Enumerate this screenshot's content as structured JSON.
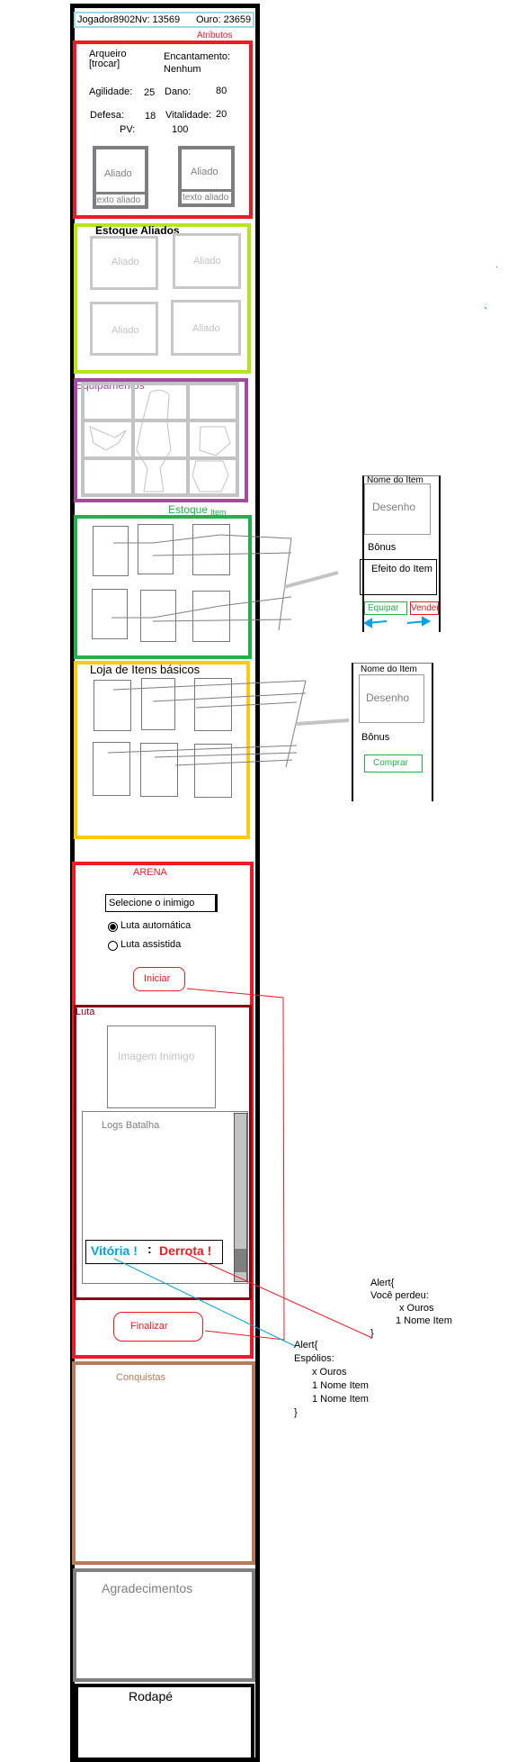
{
  "header": {
    "player": "Jogador8902",
    "level": "Nv: 13569",
    "gold": "Ouro: 23659"
  },
  "attributes": {
    "title": "Atributos",
    "class_line1": "Arqueiro",
    "class_line2": "[trocar]",
    "enchant_label": "Encantamento:",
    "enchant_value": "Nenhum",
    "agility_label": "Agilidade:",
    "agility_value": "25",
    "damage_label": "Dano:",
    "damage_value": "80",
    "defense_label": "Defesa:",
    "defense_value": "18",
    "vitality_label": "Vitalidade:",
    "vitality_value": "20",
    "hp_label": "PV:",
    "hp_value": "100",
    "ally1": "Aliado",
    "ally1_text": "texto aliado",
    "ally2": "Aliado",
    "ally2_text": "texto aliado"
  },
  "ally_stock": {
    "title": "Estoque Aliados",
    "slots": [
      "Aliado",
      "Aliado",
      "Aliado",
      "Aliado"
    ]
  },
  "equipment": {
    "title": "Equipamentos"
  },
  "item_stock": {
    "title": "Estoque",
    "title_suffix": "Item",
    "popup": {
      "name": "Nome do Item",
      "drawing": "Desenho",
      "bonus": "Bônus",
      "effect": "Efeito do Item",
      "equip": "Equipar",
      "sell": "Vender"
    }
  },
  "shop": {
    "title": "Loja de Itens básicos",
    "popup": {
      "name": "Nome do Item",
      "drawing": "Desenho",
      "bonus": "Bônus",
      "buy": "Comprar"
    }
  },
  "arena": {
    "title": "ARENA",
    "select_enemy": "Selecione o inimigo",
    "auto_fight": "Luta automática",
    "assisted_fight": "Luta assistida",
    "start": "Iniciar",
    "fight_title": "Luta",
    "enemy_image": "Imagem Inimigo",
    "battle_logs": "Logs Batalha",
    "victory": "Vitória !",
    "defeat": "Derrota !",
    "finish": "Finalizar"
  },
  "alert_defeat": [
    "Alert{",
    "Você perdeu:",
    "x Ouros",
    "1 Nome Item",
    "}"
  ],
  "alert_loot": [
    "Alert{",
    "Espólios:",
    "x Ouros",
    "1 Nome Item",
    "1 Nome Item",
    "}"
  ],
  "achievements": {
    "title": "Conquistas"
  },
  "thanks": {
    "title": "Agradecimentos"
  },
  "footer": {
    "title": "Rodapé"
  },
  "colors": {
    "attributes": "#ed1c24",
    "ally_stock": "#b5e61d",
    "equipment": "#a349a4",
    "item_stock": "#22b14c",
    "shop": "#ffc90e",
    "arena": "#ed1c24",
    "fight": "#880015",
    "achievements": "#b97a57",
    "thanks": "#7f7f7f",
    "header": "#99d9ea",
    "victory": "#00a2e8"
  }
}
